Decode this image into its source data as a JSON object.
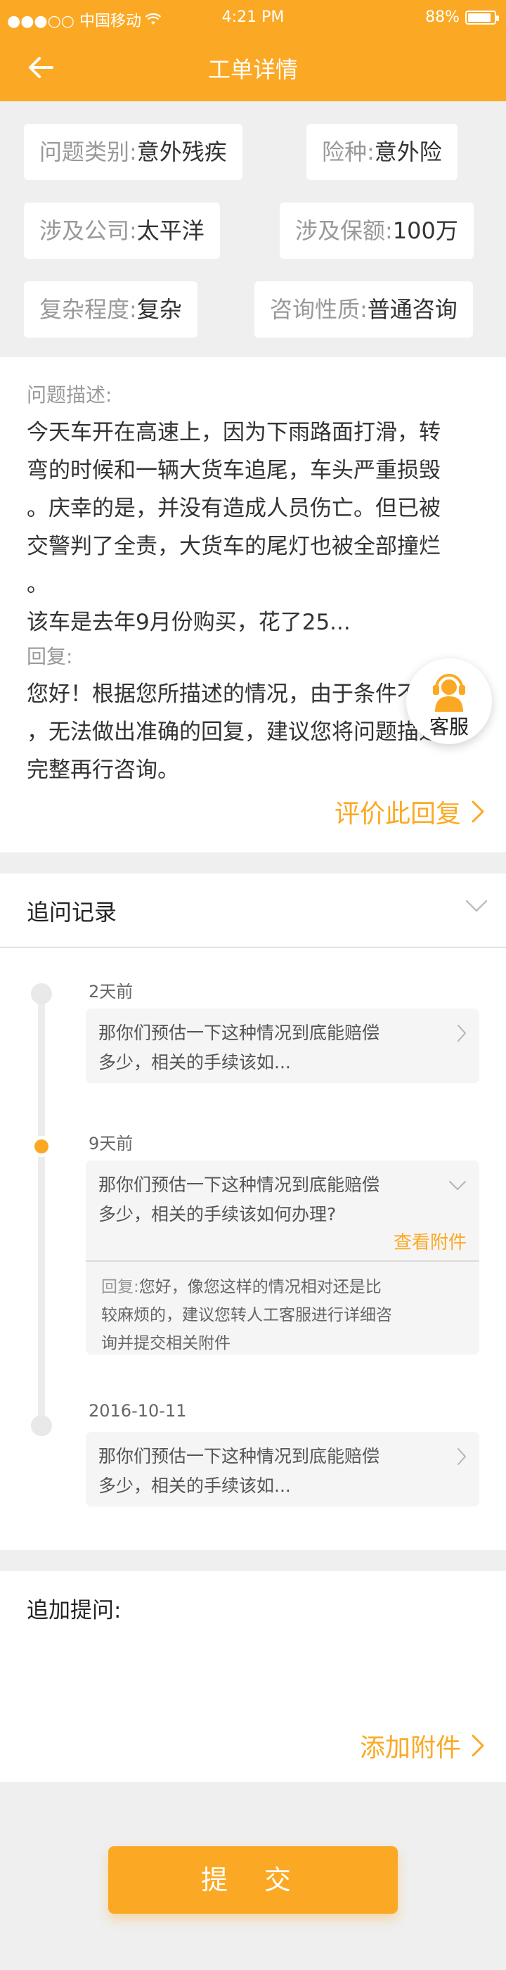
{
  "status": {
    "carrier": "●●●○○ 中国移动",
    "time": "4:21 PM",
    "battery": "88%",
    "battery_level": 0.88
  },
  "nav": {
    "title": "工单详情"
  },
  "tags": [
    {
      "key": "问题类别:",
      "value": "意外残疾"
    },
    {
      "key": "险种:",
      "value": "意外险"
    },
    {
      "key": "涉及公司:",
      "value": "太平洋"
    },
    {
      "key": "涉及保额:",
      "value": "100万"
    },
    {
      "key": "复杂程度:",
      "value": "复杂"
    },
    {
      "key": "咨询性质:",
      "value": "普通咨询"
    }
  ],
  "description": {
    "label": "问题描述:",
    "lines": [
      "今天车开在高速上，因为下雨路面打滑，转",
      "弯的时候和一辆大货车追尾，车头严重损毁",
      "。庆幸的是，并没有造成人员伤亡。但已被",
      "交警判了全责，大货车的尾灯也被全部撞烂",
      "。",
      "该车是去年9月份购买，花了25..."
    ],
    "reply_label": "回复:",
    "reply_lines": [
      "您好！根据您所描述的情况，由于条件不足",
      "，无法做出准确的回复，建议您将问题描述",
      "完整再行咨询。"
    ],
    "rate_label": "评价此回复"
  },
  "service": {
    "label": "客服"
  },
  "followups": {
    "title": "追问记录",
    "items": [
      {
        "date": "2天前",
        "text_lines": [
          "那你们预估一下这种情况到底能赔偿",
          "多少，相关的手续该如..."
        ]
      },
      {
        "date": "9天前",
        "text_lines": [
          "那你们预估一下这种情况到底能赔偿",
          "多少，相关的手续该如何办理?"
        ],
        "attachment_label": "查看附件",
        "reply_key": "回复:",
        "reply_lines": [
          "您好，像您这样的情况相对还是比",
          "较麻烦的，建议您转人工客服进行详细咨",
          "询并提交相关附件"
        ]
      },
      {
        "date": "2016-10-11",
        "text_lines": [
          "那你们预估一下这种情况到底能赔偿",
          "多少，相关的手续该如..."
        ]
      }
    ]
  },
  "ask": {
    "title": "追加提问:",
    "value": "",
    "attach_label": "添加附件"
  },
  "submit_label": "提 交"
}
